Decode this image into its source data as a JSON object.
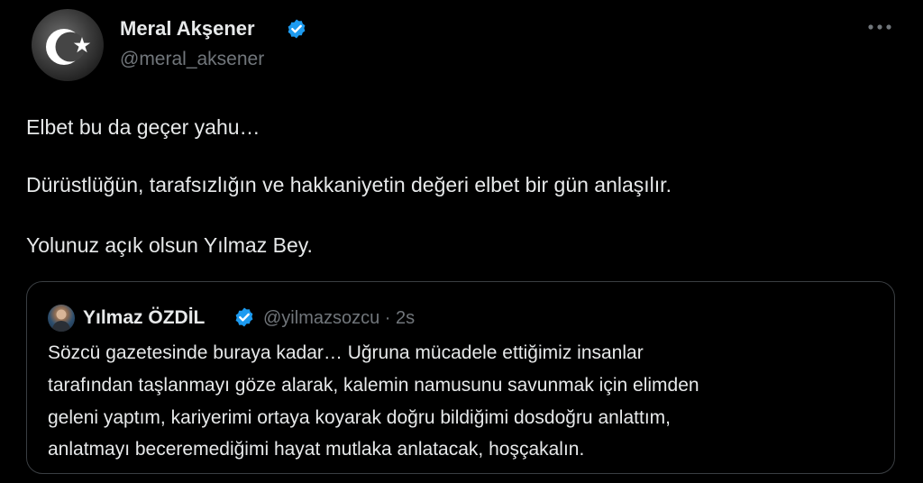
{
  "author": {
    "display_name": "Meral Akşener",
    "handle": "@meral_aksener",
    "verified": true,
    "avatar": "crescent-star-icon"
  },
  "tweet": {
    "lines": [
      "Elbet bu da geçer yahu…",
      "Dürüstlüğün, tarafsızlığın ve hakkaniyetin değeri elbet bir gün anlaşılır.",
      "Yolunuz açık olsun Yılmaz Bey."
    ]
  },
  "quoted_tweet": {
    "display_name": "Yılmaz ÖZDİL",
    "handle": "@yilmazsozcu",
    "separator": "·",
    "time": "2s",
    "verified": true,
    "lines": [
      "Sözcü gazetesinde buraya kadar… Uğruna mücadele ettiğimiz insanlar",
      "tarafından taşlanmayı göze alarak, kalemin namusunu savunmak için elimden",
      "geleni yaptım, kariyerimi ortaya koyarak doğru bildiğimi dosdoğru anlattım,",
      "anlatmayı beceremediğimi hayat mutlaka anlatacak, hoşçakalın."
    ]
  },
  "colors": {
    "background": "#000000",
    "text_primary": "#e7e9ea",
    "text_secondary": "#71767b",
    "verified_blue": "#1d9bf0",
    "border": "#3a3e42"
  }
}
